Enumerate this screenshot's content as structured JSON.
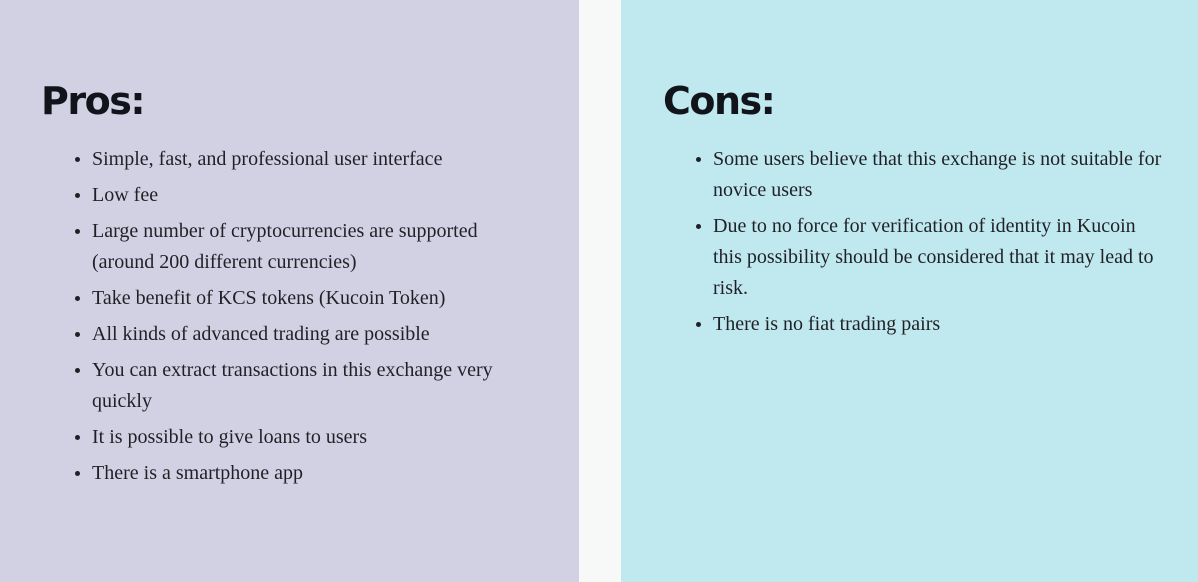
{
  "pros": {
    "title": "Pros:",
    "items": [
      "Simple, fast, and professional user interface",
      "Low fee",
      "Large number of cryptocurrencies are supported (around 200 different currencies)",
      "Take benefit of KCS tokens (Kucoin Token)",
      "All kinds of advanced trading are possible",
      "You can extract transactions in this exchange very quickly",
      "It is possible to give loans to users",
      "There is a smartphone app"
    ]
  },
  "cons": {
    "title": "Cons:",
    "items": [
      "Some users believe that this exchange is not suitable for novice users",
      "Due to no force for verification of identity in Kucoin this possibility should be considered that it may lead to risk.",
      "There is no fiat trading pairs"
    ]
  },
  "colors": {
    "pros_background": "#d2d1e3",
    "cons_background": "#c0e8ef",
    "gap_background": "#f7f9f8",
    "heading_text": "#12141b",
    "body_text": "#1f2126"
  }
}
